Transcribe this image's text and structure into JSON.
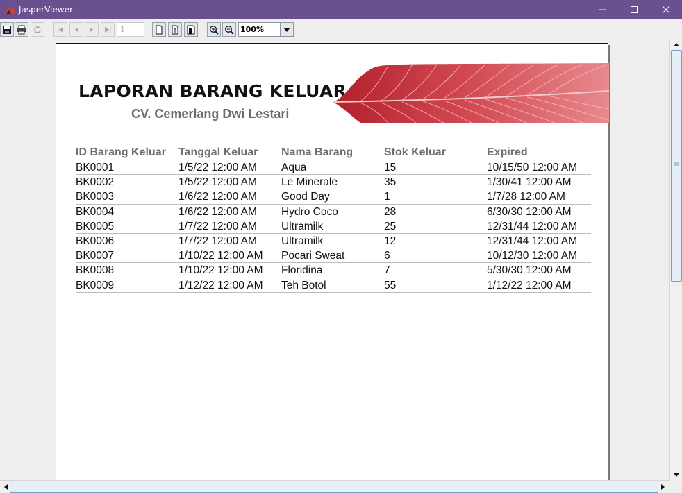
{
  "window": {
    "title": "JasperViewer"
  },
  "toolbar": {
    "page_number": "1",
    "zoom_value": "100%"
  },
  "report": {
    "title": "LAPORAN BARANG KELUAR",
    "subtitle": "CV. Cemerlang Dwi Lestari",
    "accent_color": "#c8303a",
    "columns": [
      "ID Barang Keluar",
      "Tanggal Keluar",
      "Nama Barang",
      "Stok Keluar",
      "Expired"
    ],
    "rows": [
      [
        "BK0001",
        "1/5/22 12:00 AM",
        "Aqua",
        "15",
        "10/15/50 12:00 AM"
      ],
      [
        "BK0002",
        "1/5/22 12:00 AM",
        "Le Minerale",
        "35",
        "1/30/41 12:00 AM"
      ],
      [
        "BK0003",
        "1/6/22 12:00 AM",
        "Good Day",
        "1",
        "1/7/28 12:00 AM"
      ],
      [
        "BK0004",
        "1/6/22 12:00 AM",
        "Hydro Coco",
        "28",
        "6/30/30 12:00 AM"
      ],
      [
        "BK0005",
        "1/7/22 12:00 AM",
        "Ultramilk",
        "25",
        "12/31/44 12:00 AM"
      ],
      [
        "BK0006",
        "1/7/22 12:00 AM",
        "Ultramilk",
        "12",
        "12/31/44 12:00 AM"
      ],
      [
        "BK0007",
        "1/10/22 12:00 AM",
        "Pocari Sweat",
        "6",
        "10/12/30 12:00 AM"
      ],
      [
        "BK0008",
        "1/10/22 12:00 AM",
        "Floridina",
        "7",
        "5/30/30 12:00 AM"
      ],
      [
        "BK0009",
        "1/12/22 12:00 AM",
        "Teh Botol",
        "55",
        "1/12/22 12:00 AM"
      ]
    ]
  },
  "colors": {
    "titlebar": "#69508e",
    "header_text": "#6e6e6e",
    "subtitle_text": "#6b6b6b"
  }
}
